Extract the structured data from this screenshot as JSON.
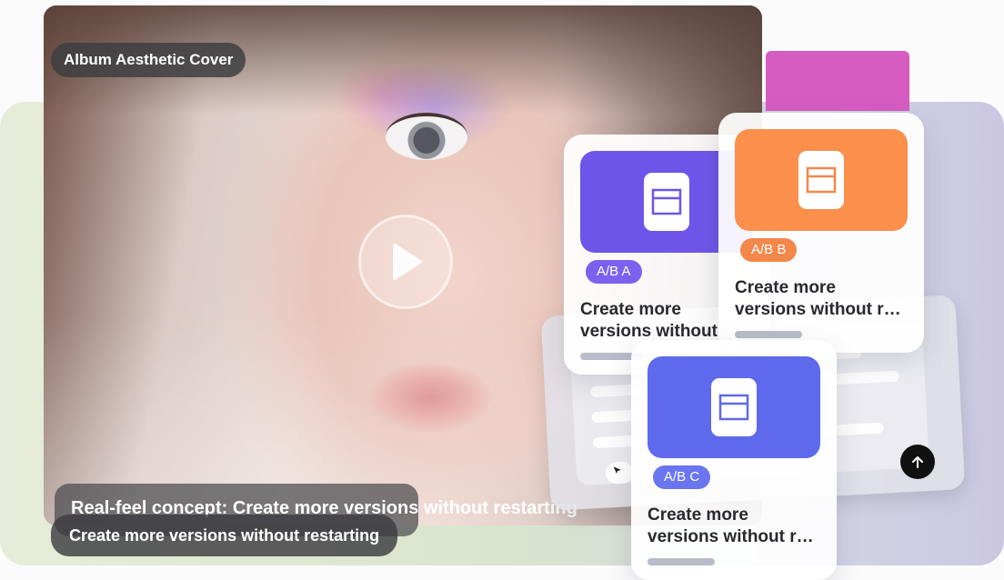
{
  "cover_label": "Album Aesthetic Cover",
  "caption_back": "Real-feel concept: Create more versions without restarting",
  "caption_front": "Create more versions without restarting",
  "cards": [
    {
      "badge": "A/B A",
      "title_line1": "Create more",
      "title_line2": "versions without restarting",
      "accent": "#6e55e9",
      "badge_bg": "#7a62ef"
    },
    {
      "badge": "A/B B",
      "title_line1": "Create more",
      "title_line2": "versions without restarting",
      "accent": "#fb8f4b",
      "badge_bg": "#f4874a"
    },
    {
      "badge": "A/B C",
      "title_line1": "Create more",
      "title_line2": "versions without restarting",
      "accent": "#5f69ec",
      "badge_bg": "#6b75ef"
    }
  ],
  "icons": {
    "play": "play-icon",
    "template": "template-icon",
    "send": "arrow-up-icon",
    "cursor": "cursor-icon"
  },
  "colors": {
    "pink_tab": "#d65cc2",
    "send_button": "#111111"
  }
}
